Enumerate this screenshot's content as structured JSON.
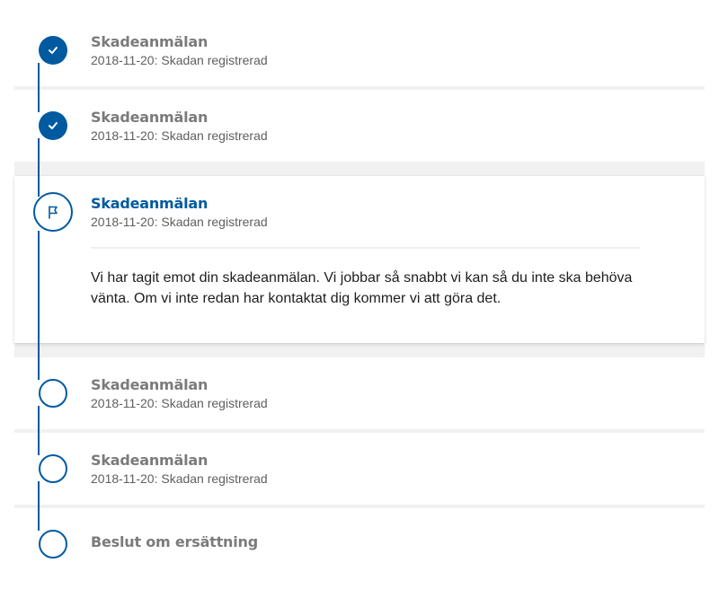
{
  "colors": {
    "accent": "#005aa0",
    "muted_title": "#7b7b7b",
    "divider": "#f1f1f1"
  },
  "steps": [
    {
      "status": "done",
      "icon": "check-icon",
      "title": "Skadeanmälan",
      "subtitle": "2018-11-20: Skadan registrerad"
    },
    {
      "status": "done",
      "icon": "check-icon",
      "title": "Skadeanmälan",
      "subtitle": "2018-11-20: Skadan registrerad"
    },
    {
      "status": "current",
      "icon": "flag-icon",
      "title": "Skadeanmälan",
      "subtitle": "2018-11-20: Skadan registrerad",
      "description": "Vi har tagit emot din skadeanmälan. Vi jobbar så snabbt vi kan så du inte ska behöva vänta. Om vi inte redan har kontaktat dig kommer vi att göra det."
    },
    {
      "status": "upcoming",
      "icon": "empty-circle-icon",
      "title": "Skadeanmälan",
      "subtitle": "2018-11-20: Skadan registrerad"
    },
    {
      "status": "upcoming",
      "icon": "empty-circle-icon",
      "title": "Skadeanmälan",
      "subtitle": "2018-11-20: Skadan registrerad"
    },
    {
      "status": "upcoming",
      "icon": "empty-circle-icon",
      "title": "Beslut om ersättning"
    }
  ]
}
